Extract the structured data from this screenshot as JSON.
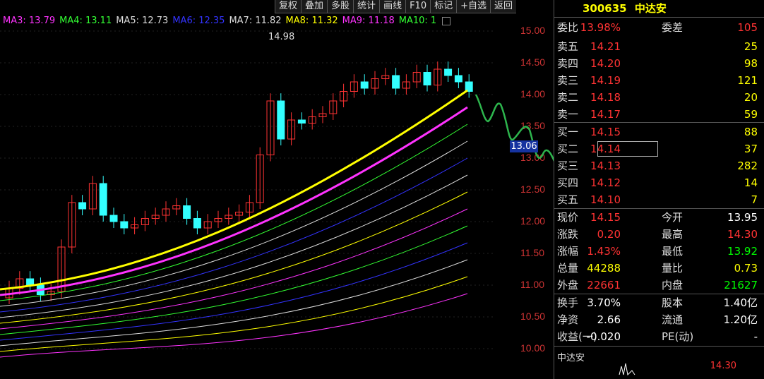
{
  "toolbar": [
    "复权",
    "叠加",
    "多股",
    "统计",
    "画线",
    "F10",
    "标记",
    "+自选",
    "返回"
  ],
  "ma_legend": [
    {
      "label": "MA3: 13.79",
      "color": "#ff33ff"
    },
    {
      "label": "MA4: 13.11",
      "color": "#33ff33"
    },
    {
      "label": "MA5: 12.73",
      "color": "#dddddd"
    },
    {
      "label": "MA6: 12.35",
      "color": "#3333ff"
    },
    {
      "label": "MA7: 11.82",
      "color": "#dddddd"
    },
    {
      "label": "MA8: 11.32",
      "color": "#ffff00"
    },
    {
      "label": "MA9: 11.18",
      "color": "#ff33ff"
    },
    {
      "label": "MA10: 1",
      "color": "#33ff33"
    }
  ],
  "price_axis": [
    "15.00",
    "14.50",
    "14.00",
    "13.50",
    "13.00",
    "12.50",
    "12.00",
    "11.50",
    "11.00",
    "10.50",
    "10.00"
  ],
  "high_marker": "14.98",
  "cursor_price": "13.06",
  "stock": {
    "code": "300635",
    "name": "中达安"
  },
  "quote": {
    "wei_bi_label": "委比",
    "wei_bi": "13.98%",
    "wei_cha_label": "委差",
    "wei_cha": "105",
    "sells": [
      {
        "label": "卖五",
        "price": "14.21",
        "vol": "25"
      },
      {
        "label": "卖四",
        "price": "14.20",
        "vol": "98"
      },
      {
        "label": "卖三",
        "price": "14.19",
        "vol": "121"
      },
      {
        "label": "卖二",
        "price": "14.18",
        "vol": "20"
      },
      {
        "label": "卖一",
        "price": "14.17",
        "vol": "59"
      }
    ],
    "buys": [
      {
        "label": "买一",
        "price": "14.15",
        "vol": "88"
      },
      {
        "label": "买二",
        "price": "14.14",
        "vol": "37"
      },
      {
        "label": "买三",
        "price": "14.13",
        "vol": "282"
      },
      {
        "label": "买四",
        "price": "14.12",
        "vol": "14"
      },
      {
        "label": "买五",
        "price": "14.10",
        "vol": "7"
      }
    ],
    "stats": [
      {
        "l1": "现价",
        "v1": "14.15",
        "c1": "red",
        "l2": "今开",
        "v2": "13.95",
        "c2": "white"
      },
      {
        "l1": "涨跌",
        "v1": "0.20",
        "c1": "red",
        "l2": "最高",
        "v2": "14.30",
        "c2": "red"
      },
      {
        "l1": "涨幅",
        "v1": "1.43%",
        "c1": "red",
        "l2": "最低",
        "v2": "13.92",
        "c2": "green"
      },
      {
        "l1": "总量",
        "v1": "44288",
        "c1": "yellow",
        "l2": "量比",
        "v2": "0.73",
        "c2": "yellow"
      },
      {
        "l1": "外盘",
        "v1": "22661",
        "c1": "red",
        "l2": "内盘",
        "v2": "21627",
        "c2": "green"
      }
    ],
    "stats2": [
      {
        "l1": "换手",
        "v1": "3.70%",
        "l2": "股本",
        "v2": "1.40亿"
      },
      {
        "l1": "净资",
        "v1": "2.66",
        "l2": "流通",
        "v2": "1.20亿"
      },
      {
        "l1": "收益(一)",
        "v1": "-0.020",
        "l2": "PE(动)",
        "v2": "-"
      }
    ]
  },
  "mini_chart": {
    "title": "中达安",
    "price": "14.30"
  }
}
